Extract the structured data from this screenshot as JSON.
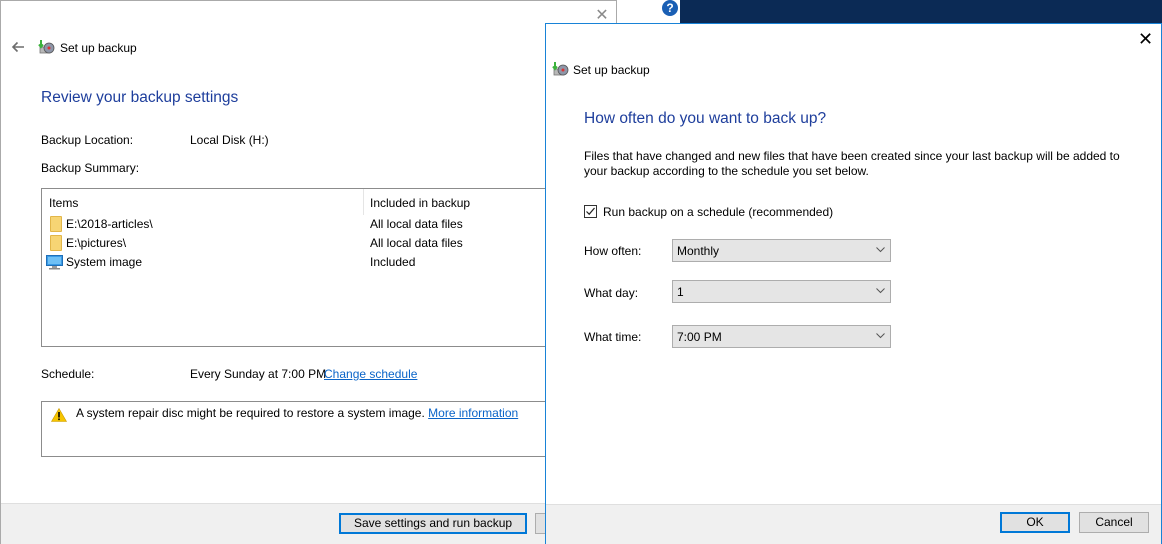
{
  "background_window": {
    "title": "Set up backup",
    "heading": "Review your backup settings",
    "backup_location_label": "Backup Location:",
    "backup_location_value": "Local Disk (H:)",
    "backup_summary_label": "Backup Summary:",
    "table": {
      "columns": [
        "Items",
        "Included in backup"
      ],
      "rows": [
        {
          "icon": "folder-icon",
          "item": "E:\\2018-articles\\",
          "included": "All local data files"
        },
        {
          "icon": "folder-icon",
          "item": "E:\\pictures\\",
          "included": "All local data files"
        },
        {
          "icon": "monitor-icon",
          "item": "System image",
          "included": "Included"
        }
      ]
    },
    "schedule_label": "Schedule:",
    "schedule_value": "Every Sunday at 7:00 PM",
    "change_schedule_link": "Change schedule",
    "warning_text": "A system repair disc might be required to restore a system image.",
    "more_information_link": "More information",
    "save_button": "Save settings and run backup",
    "close_symbol": "✕"
  },
  "help_symbol": "?",
  "dialog": {
    "title": "Set up backup",
    "heading": "How often do you want to back up?",
    "description_line1": "Files that have changed and new files that have been created since your last backup will be added to",
    "description_line2": "your backup according to the schedule you set below.",
    "run_on_schedule_label": "Run backup on a schedule (recommended)",
    "run_on_schedule_checked": true,
    "how_often_label": "How often:",
    "how_often_value": "Monthly",
    "what_day_label": "What day:",
    "what_day_value": "1",
    "what_time_label": "What time:",
    "what_time_value": "7:00 PM",
    "ok_button": "OK",
    "cancel_button": "Cancel",
    "close_symbol": "✕"
  },
  "colors": {
    "heading_blue": "#1e3e9c",
    "link_blue": "#0a64c8",
    "accent_border": "#0078d7",
    "desktop": "#0b2a55"
  }
}
